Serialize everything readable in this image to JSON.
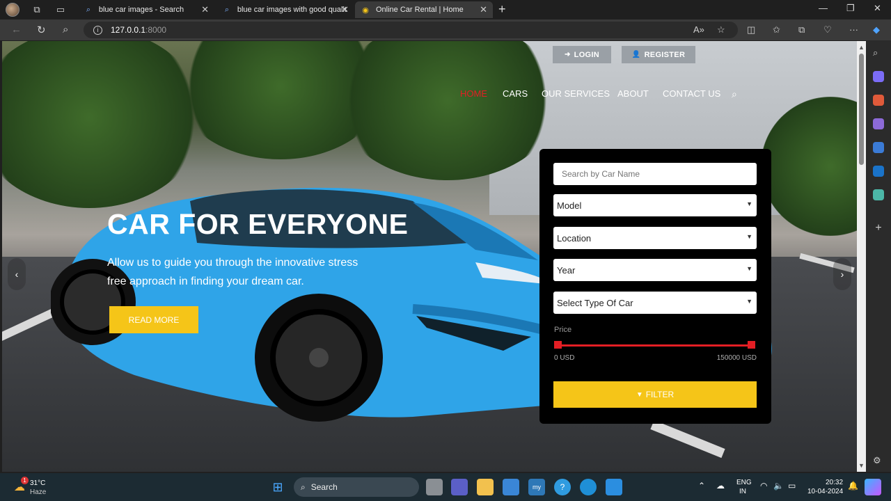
{
  "browser": {
    "tabs": [
      {
        "title": "blue car images - Search",
        "active": false
      },
      {
        "title": "blue car images with good qualit",
        "active": false
      },
      {
        "title": "Online Car Rental | Home",
        "active": true
      }
    ],
    "url_host": "127.0.0.1",
    "url_port": ":8000"
  },
  "header": {
    "login_label": "LOGIN",
    "register_label": "REGISTER",
    "menu": [
      "HOME",
      "CARS",
      "OUR SERVICES",
      "ABOUT",
      "CONTACT US"
    ],
    "active_menu": "HOME"
  },
  "hero": {
    "title": "CAR FOR EVERYONE",
    "text": "Allow us to guide you through the innovative stress free approach in finding your dream car.",
    "button": "READ MORE"
  },
  "filter": {
    "search_placeholder": "Search by Car Name",
    "model": "Model",
    "location": "Location",
    "year": "Year",
    "type": "Select Type Of Car",
    "price_label": "Price",
    "price_min": "0 USD",
    "price_max": "150000 USD",
    "price_range_fraction": [
      0,
      1
    ],
    "filter_button": "FILTER"
  },
  "taskbar": {
    "weather_temp": "31°C",
    "weather_desc": "Haze",
    "weather_badge": "1",
    "search": "Search",
    "lang_top": "ENG",
    "lang_bottom": "IN",
    "time": "20:32",
    "date": "10-04-2024"
  },
  "colors": {
    "accent_red": "#e31e24",
    "accent_yellow": "#f5c518"
  }
}
